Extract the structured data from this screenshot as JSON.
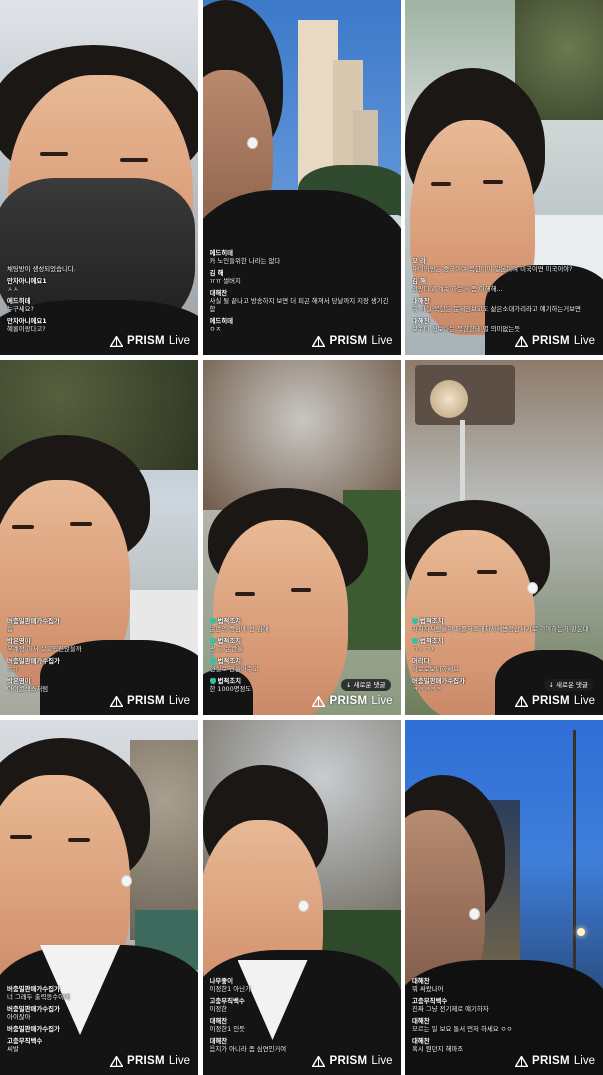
{
  "brand": {
    "name": "PRISM",
    "suffix": "Live",
    "logo_icon": "prism-triangle-icon"
  },
  "tiles": [
    {
      "notice": "채팅방이 생성되었습니다.",
      "messages": [
        {
          "name": "만차아니에요1",
          "text": "ㅅㅅ"
        },
        {
          "name": "에드히데",
          "text": "누구세요?"
        },
        {
          "name": "만차아니에요1",
          "text": "혜롱이랑다고?"
        }
      ]
    },
    {
      "messages": [
        {
          "name": "에드히데",
          "text": "카 노인들위한 나라는 없다"
        },
        {
          "name": "김 해",
          "text": "ㅠㅠ 썰버지"
        },
        {
          "name": "대해찬",
          "text": "사실 될 끝나고 방송하지 보면 더 피곤 해져서 당날까지 지장 생기긴 함"
        },
        {
          "name": "에드히데",
          "text": "ㅇㅈ"
        }
      ]
    },
    {
      "messages": [
        {
          "name": "모 라",
          "text": "재미어링은 중국이며 북한이며 일본이며 미국이면 미국이야?"
        },
        {
          "name": "김 해",
          "text": "안랑다고 계속 하는거 좀 이해해..."
        },
        {
          "name": "대해찬",
          "text": "뭐 사실 북한은 문제인보고도 삶은소대가리라고 얘기하는거보면"
        },
        {
          "name": "대해찬",
          "text": "보수나 진보나는 북한한테 별 의미없는듯"
        }
      ]
    },
    {
      "messages": [
        {
          "name": "버충밀판매가수집가",
          "text": "흠"
        },
        {
          "name": "박은영이",
          "text": "부계정 파서 살고있진않을까"
        },
        {
          "name": "버충밀판매가수집가",
          "text": "ㅠㅠ"
        },
        {
          "name": "박은영이",
          "text": "아이콘섹스처럼"
        }
      ]
    },
    {
      "new_comments": "새로운 댓글",
      "messages": [
        {
          "name": "법적조치",
          "text": "논란의 중심에 선 김해",
          "badge": true
        },
        {
          "name": "법적조치",
          "text": "광 그 논란들",
          "badge": true
        },
        {
          "name": "법적조치",
          "text": "현실로 만들어주고",
          "badge": true
        },
        {
          "name": "법적조치",
          "text": "한 1000명정도",
          "badge": true
        }
      ]
    },
    {
      "new_comments": "새로운 댓글",
      "messages": [
        {
          "name": "법적조치",
          "text": "지지자사람들이 퍼즐처즈개처사세변정산사기로 가야하는거 같은대",
          "badge": true
        },
        {
          "name": "법적조치",
          "text": "ㄱㅅㄱㅅ",
          "badge": true
        },
        {
          "name": "머리다",
          "text": "서로로보니하세요"
        },
        {
          "name": "버충밀판매가수집가",
          "text": "ㅋㅋㅋㅋㅋ"
        }
      ]
    },
    {
      "messages": [
        {
          "name": "버충밀판매가수집가",
          "text": "너 그래두 출력응수이에"
        },
        {
          "name": "버충밀판매가수집가",
          "text": "아이잖아"
        },
        {
          "name": "버충밀판매가수집가",
          "text": ""
        },
        {
          "name": "고충무직백수",
          "text": "씨발"
        }
      ]
    },
    {
      "messages": [
        {
          "name": "나무좋이",
          "text": "이정한1 아닌가"
        },
        {
          "name": "고충무직백수",
          "text": "이정한"
        },
        {
          "name": "대해찬",
          "text": "이정한1 인듯"
        },
        {
          "name": "대해찬",
          "text": "음지가 아니라 좀 심연인거여"
        }
      ]
    },
    {
      "messages": [
        {
          "name": "대해찬",
          "text": "뭐 싸왔나어"
        },
        {
          "name": "고충무직백수",
          "text": "진짜 그냥 전기제로 얘기하자"
        },
        {
          "name": "대해찬",
          "text": "모르는 일 보요 통서 먼저 하세요 ㅇㅇ"
        },
        {
          "name": "대해찬",
          "text": "혹시 뭔던지 해마조"
        }
      ]
    }
  ]
}
